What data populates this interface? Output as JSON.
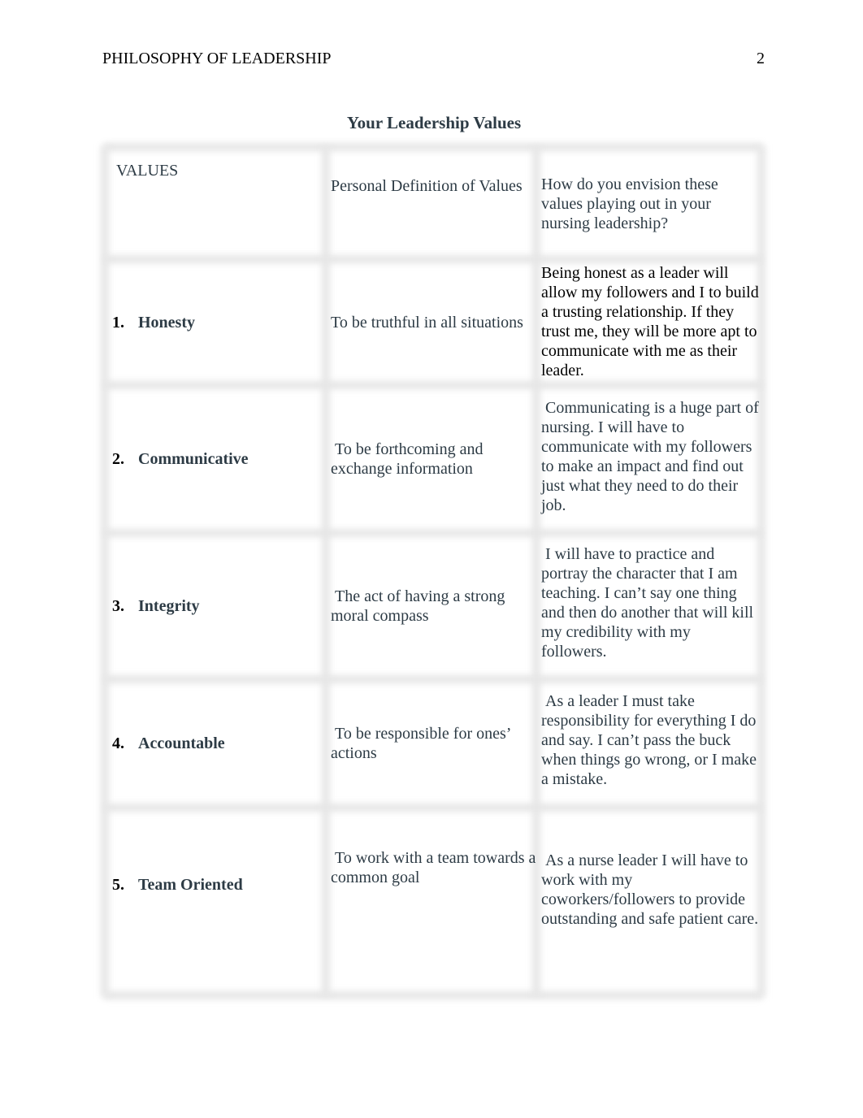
{
  "header": {
    "running_head": "PHILOSOPHY OF LEADERSHIP",
    "page_number": "2"
  },
  "title": "Your Leadership Values",
  "table": {
    "headers": {
      "values": "VALUES",
      "definition": "Personal Definition of Values",
      "envision": "How do you envision these values playing out in your nursing leadership?"
    },
    "rows": [
      {
        "number": "1.",
        "value": "Honesty",
        "definition": "To be truthful in all situations",
        "envision": "Being honest as a leader will allow my followers and I to build a trusting relationship. If they trust me, they will be more apt to communicate with me as their leader."
      },
      {
        "number": "2.",
        "value": "Communicative",
        "definition": " To be forthcoming and exchange information",
        "envision": " Communicating is a huge part of nursing. I will have to communicate with my followers to make an impact and find out just what they need to do their job."
      },
      {
        "number": "3.",
        "value": "Integrity",
        "definition": " The act of having a strong moral compass",
        "envision": " I will have to practice and portray the character that I am teaching. I can’t say one thing and then do another that will kill my credibility with my followers."
      },
      {
        "number": "4.",
        "value": "Accountable",
        "definition": " To be responsible for ones’ actions",
        "envision": " As a leader I must take responsibility for everything I do and say. I can’t pass the buck when things go wrong, or I make a mistake."
      },
      {
        "number": "5.",
        "value": "Team Oriented",
        "definition": " To work with a team towards a common goal",
        "envision": " As a nurse leader I will have to work with my coworkers/followers to provide outstanding and safe patient care."
      }
    ]
  }
}
